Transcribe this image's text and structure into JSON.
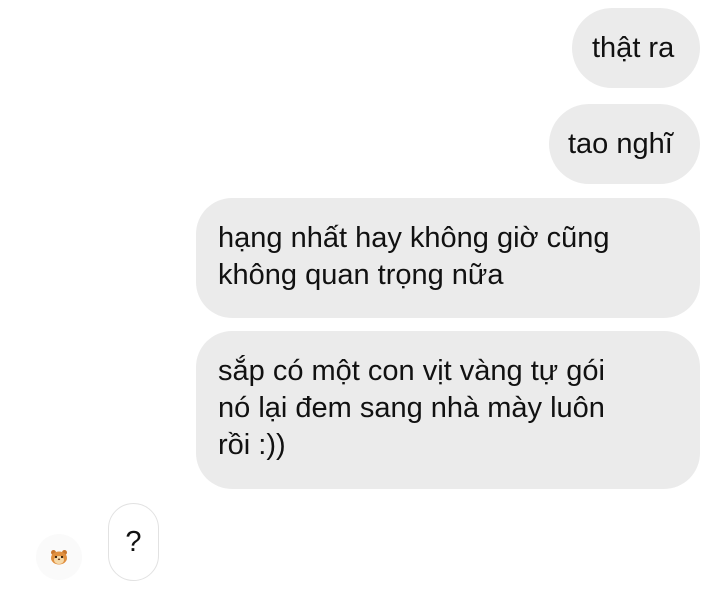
{
  "messages": {
    "sent": [
      {
        "lines": [
          "thật ra"
        ]
      },
      {
        "lines": [
          "tao nghĩ"
        ]
      },
      {
        "lines": [
          "hạng nhất hay không giờ cũng",
          "không quan trọng nữa"
        ]
      },
      {
        "lines": [
          "sắp có một con vịt vàng tự gói",
          "nó lại đem sang nhà mày luôn",
          "rồi :))"
        ]
      }
    ],
    "received": [
      {
        "text": "?"
      }
    ]
  },
  "avatar": {
    "icon": "hamster-icon"
  },
  "colors": {
    "sent_bubble": "#ebebeb",
    "received_border": "#e2e2e2"
  }
}
